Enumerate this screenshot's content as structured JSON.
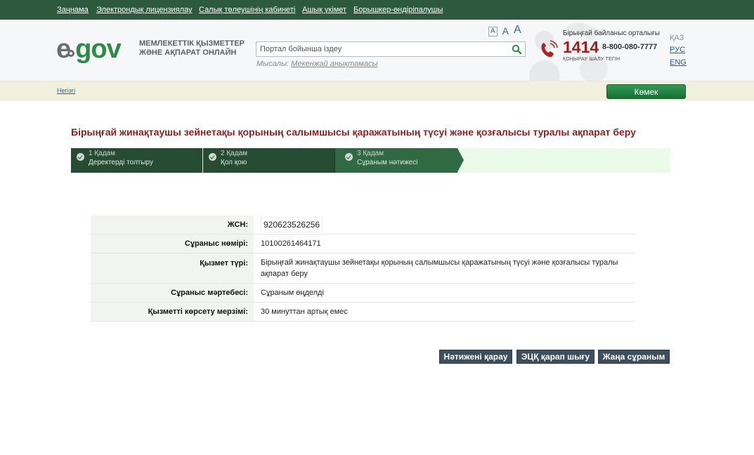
{
  "topnav": {
    "items": [
      "Заңнама",
      "Электрондық лицензиялау",
      "Салық төлеушінің кабинеті",
      "Ашық үкімет",
      "Борышкер-өндіріпалушы"
    ]
  },
  "header": {
    "logo_e": "e",
    "logo_gov": "gov",
    "tagline_line1": "МЕМЛЕКЕТТІК ҚЫЗМЕТТЕР",
    "tagline_line2": "ЖӘНЕ АҚПАРАТ ОНЛАЙН",
    "font_sizes": [
      "A",
      "A",
      "A"
    ],
    "search_placeholder": "Портал бойынша іздеу",
    "example_prefix": "Мысалы:",
    "example_link": "Мекенжай анықтамасы",
    "contact_title": "Бірыңғай байланыс орталығы",
    "short_number": "1414",
    "long_number": "8-800-080-7777",
    "free_call": "ҚОҢЫРАУ ШАЛУ ТЕГІН",
    "languages": [
      "ҚАЗ",
      "РУС",
      "ENG"
    ]
  },
  "crumb": {
    "home": "Негізгі",
    "help": "Көмек"
  },
  "page": {
    "title": "Бірыңғай жинақтаушы зейнетақы қорының салымшысы қаражатының түсуі және қозғалысы туралы ақпарат беру"
  },
  "steps": [
    {
      "num": "1 Қадам",
      "label": "Деректерді толтыру"
    },
    {
      "num": "2 Қадам",
      "label": "Қол қою"
    },
    {
      "num": "3 Қадам",
      "label": "Сұраным нәтижесі"
    }
  ],
  "info": {
    "rows": [
      {
        "label": "ЖСН:",
        "value": "920623526256"
      },
      {
        "label": "Сұраныс нөмірі:",
        "value": "10100261464171"
      },
      {
        "label": "Қызмет түрі:",
        "value": "Бірыңғай жинақтаушы зейнетақы қорының салымшысы қаражатының түсуі және қозғалысы туралы ақпарат беру"
      },
      {
        "label": "Сұраныс мәртебесі:",
        "value": "Сұраным өңделді"
      },
      {
        "label": "Қызметті көрсету мерзімі:",
        "value": "30 минуттан артық емес"
      }
    ]
  },
  "actions": {
    "view_result": "Нәтижені қарау",
    "logout_eds": "ЭЦҚ қарап шығу",
    "new_request": "Жаңа сұраным"
  },
  "colors": {
    "topnav_bg": "#2d5a3c",
    "title_red": "#8a1f1f",
    "step_dark": "#264d33",
    "step_active": "#2f6a43",
    "button_bg": "#3d4f5c"
  }
}
